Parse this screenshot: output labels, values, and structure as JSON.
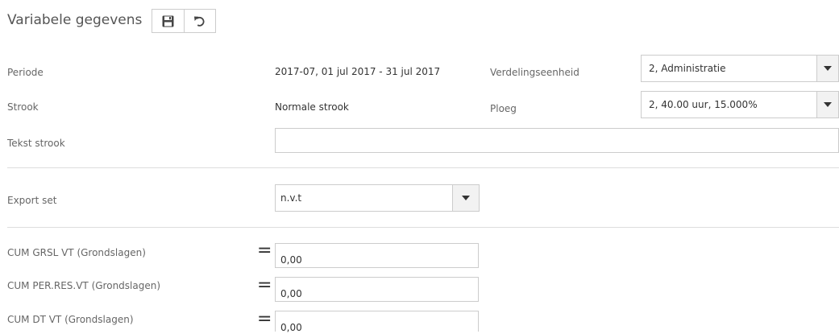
{
  "header": {
    "title": "Variabele gegevens",
    "save_icon": "floppy-disk-icon",
    "undo_icon": "undo-icon"
  },
  "form": {
    "periode_label": "Periode",
    "periode_value": "2017-07, 01 jul 2017 - 31 jul 2017",
    "verdelingseenheid_label": "Verdelingseenheid",
    "verdelingseenheid_value": "2, Administratie",
    "strook_label": "Strook",
    "strook_value": "Normale strook",
    "ploeg_label": "Ploeg",
    "ploeg_value": "2, 40.00 uur, 15.000%",
    "tekst_strook_label": "Tekst strook",
    "tekst_strook_value": "",
    "export_set_label": "Export set",
    "export_set_value": "n.v.t"
  },
  "cumulatives": [
    {
      "label": "CUM GRSL VT (Grondslagen)",
      "operator": "=",
      "value": "0,00"
    },
    {
      "label": "CUM PER.RES.VT (Grondslagen)",
      "operator": "=",
      "value": "0,00"
    },
    {
      "label": "CUM DT VT (Grondslagen)",
      "operator": "=",
      "value": "0,00"
    }
  ],
  "colors": {
    "border": "#cccccc",
    "divider": "#dddddd",
    "label_text": "#666666",
    "value_text": "#333333",
    "arrow_bg": "#f2f2f2"
  }
}
